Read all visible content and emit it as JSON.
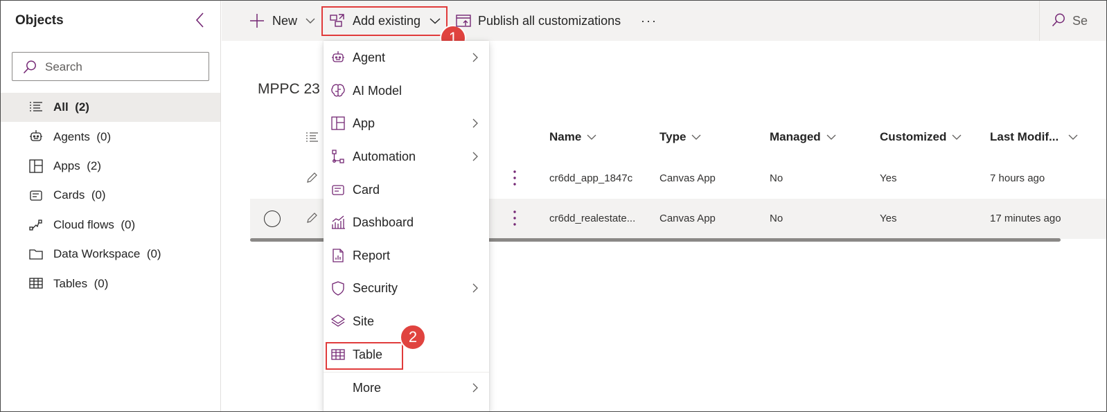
{
  "sidebar": {
    "title": "Objects",
    "search_placeholder": "Search",
    "items": [
      {
        "label": "All",
        "count": "(2)",
        "icon": "list-icon"
      },
      {
        "label": "Agents",
        "count": "(0)",
        "icon": "bot-icon"
      },
      {
        "label": "Apps",
        "count": "(2)",
        "icon": "app-icon"
      },
      {
        "label": "Cards",
        "count": "(0)",
        "icon": "card-icon"
      },
      {
        "label": "Cloud flows",
        "count": "(0)",
        "icon": "flow-icon"
      },
      {
        "label": "Data Workspace",
        "count": "(0)",
        "icon": "folder-icon"
      },
      {
        "label": "Tables",
        "count": "(0)",
        "icon": "table-icon"
      }
    ]
  },
  "toolbar": {
    "new_label": "New",
    "add_existing_label": "Add existing",
    "publish_label": "Publish all customizations",
    "more_label": "···",
    "search_label": "Se"
  },
  "badges": {
    "one": "1",
    "two": "2"
  },
  "main": {
    "title": "MPPC 23",
    "columns": [
      "Name",
      "Type",
      "Managed",
      "Customized",
      "Last Modif..."
    ],
    "rows": [
      {
        "name": "cr6dd_app_1847c",
        "type": "Canvas App",
        "managed": "No",
        "customized": "Yes",
        "modified": "7 hours ago"
      },
      {
        "name": "cr6dd_realestate...",
        "type": "Canvas App",
        "managed": "No",
        "customized": "Yes",
        "modified": "17 minutes ago"
      }
    ]
  },
  "menu": {
    "items": [
      {
        "label": "Agent",
        "icon": "bot-icon",
        "submenu": true
      },
      {
        "label": "AI Model",
        "icon": "brain-icon",
        "submenu": false
      },
      {
        "label": "App",
        "icon": "app-icon",
        "submenu": true
      },
      {
        "label": "Automation",
        "icon": "automation-icon",
        "submenu": true
      },
      {
        "label": "Card",
        "icon": "card-icon",
        "submenu": false
      },
      {
        "label": "Dashboard",
        "icon": "dashboard-icon",
        "submenu": false
      },
      {
        "label": "Report",
        "icon": "report-icon",
        "submenu": false
      },
      {
        "label": "Security",
        "icon": "shield-icon",
        "submenu": true
      },
      {
        "label": "Site",
        "icon": "site-icon",
        "submenu": false
      },
      {
        "label": "Table",
        "icon": "table-icon",
        "submenu": false
      },
      {
        "label": "More",
        "icon": "",
        "submenu": true
      }
    ]
  },
  "colors": {
    "accent": "#742774",
    "highlight": "#e03b3b"
  }
}
